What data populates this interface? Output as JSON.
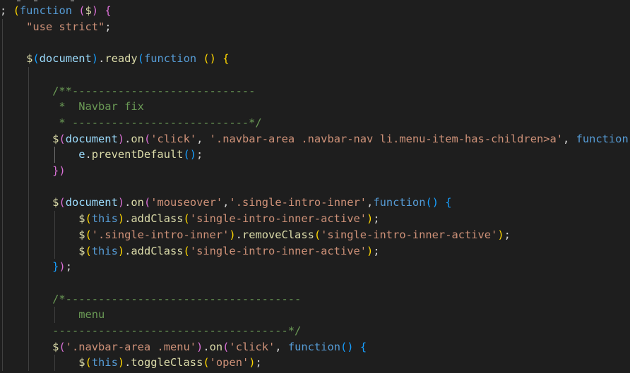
{
  "editor": {
    "lines": [
      [
        {
          "t": ";",
          "c": "punc"
        },
        {
          "t": " ",
          "c": "punc"
        },
        {
          "t": "(",
          "c": "b1"
        },
        {
          "t": "function",
          "c": "kw"
        },
        {
          "t": " ",
          "c": "punc"
        },
        {
          "t": "(",
          "c": "b2"
        },
        {
          "t": "$",
          "c": "fn"
        },
        {
          "t": ")",
          "c": "b2"
        },
        {
          "t": " ",
          "c": "punc"
        },
        {
          "t": "{",
          "c": "b2"
        }
      ],
      [
        {
          "t": "    ",
          "c": "punc"
        },
        {
          "t": "\"use strict\"",
          "c": "str"
        },
        {
          "t": ";",
          "c": "punc"
        }
      ],
      [],
      [
        {
          "t": "    ",
          "c": "punc"
        },
        {
          "t": "$",
          "c": "fn"
        },
        {
          "t": "(",
          "c": "b3"
        },
        {
          "t": "document",
          "c": "var"
        },
        {
          "t": ")",
          "c": "b3"
        },
        {
          "t": ".",
          "c": "punc"
        },
        {
          "t": "ready",
          "c": "fn"
        },
        {
          "t": "(",
          "c": "b3"
        },
        {
          "t": "function",
          "c": "kw"
        },
        {
          "t": " ",
          "c": "punc"
        },
        {
          "t": "()",
          "c": "b1"
        },
        {
          "t": " ",
          "c": "punc"
        },
        {
          "t": "{",
          "c": "b1"
        }
      ],
      [],
      [
        {
          "t": "        ",
          "c": "punc"
        },
        {
          "t": "/**----------------------------",
          "c": "cmt"
        }
      ],
      [
        {
          "t": "         ",
          "c": "punc"
        },
        {
          "t": "*  Navbar fix",
          "c": "cmt"
        }
      ],
      [
        {
          "t": "         ",
          "c": "punc"
        },
        {
          "t": "* ---------------------------*/",
          "c": "cmt"
        }
      ],
      [
        {
          "t": "        ",
          "c": "punc"
        },
        {
          "t": "$",
          "c": "fn"
        },
        {
          "t": "(",
          "c": "b2"
        },
        {
          "t": "document",
          "c": "var"
        },
        {
          "t": ")",
          "c": "b2"
        },
        {
          "t": ".",
          "c": "punc"
        },
        {
          "t": "on",
          "c": "fn"
        },
        {
          "t": "(",
          "c": "b2"
        },
        {
          "t": "'click'",
          "c": "str"
        },
        {
          "t": ", ",
          "c": "punc"
        },
        {
          "t": "'.navbar-area .navbar-nav li.menu-item-has-children>a'",
          "c": "str"
        },
        {
          "t": ", ",
          "c": "punc"
        },
        {
          "t": "function",
          "c": "kw"
        }
      ],
      [
        {
          "t": "            ",
          "c": "punc"
        },
        {
          "t": "e",
          "c": "var"
        },
        {
          "t": ".",
          "c": "punc"
        },
        {
          "t": "preventDefault",
          "c": "fn"
        },
        {
          "t": "()",
          "c": "b3"
        },
        {
          "t": ";",
          "c": "punc"
        }
      ],
      [
        {
          "t": "        ",
          "c": "punc"
        },
        {
          "t": "})",
          "c": "b2"
        }
      ],
      [],
      [
        {
          "t": "        ",
          "c": "punc"
        },
        {
          "t": "$",
          "c": "fn"
        },
        {
          "t": "(",
          "c": "b2"
        },
        {
          "t": "document",
          "c": "var"
        },
        {
          "t": ")",
          "c": "b2"
        },
        {
          "t": ".",
          "c": "punc"
        },
        {
          "t": "on",
          "c": "fn"
        },
        {
          "t": "(",
          "c": "b2"
        },
        {
          "t": "'mouseover'",
          "c": "str"
        },
        {
          "t": ",",
          "c": "punc"
        },
        {
          "t": "'.single-intro-inner'",
          "c": "str"
        },
        {
          "t": ",",
          "c": "punc"
        },
        {
          "t": "function",
          "c": "kw"
        },
        {
          "t": "()",
          "c": "b3"
        },
        {
          "t": " ",
          "c": "punc"
        },
        {
          "t": "{",
          "c": "b3"
        }
      ],
      [
        {
          "t": "            ",
          "c": "punc"
        },
        {
          "t": "$",
          "c": "fn"
        },
        {
          "t": "(",
          "c": "b1"
        },
        {
          "t": "this",
          "c": "kw"
        },
        {
          "t": ")",
          "c": "b1"
        },
        {
          "t": ".",
          "c": "punc"
        },
        {
          "t": "addClass",
          "c": "fn"
        },
        {
          "t": "(",
          "c": "b1"
        },
        {
          "t": "'single-intro-inner-active'",
          "c": "str"
        },
        {
          "t": ")",
          "c": "b1"
        },
        {
          "t": ";",
          "c": "punc"
        }
      ],
      [
        {
          "t": "            ",
          "c": "punc"
        },
        {
          "t": "$",
          "c": "fn"
        },
        {
          "t": "(",
          "c": "b1"
        },
        {
          "t": "'.single-intro-inner'",
          "c": "str"
        },
        {
          "t": ")",
          "c": "b1"
        },
        {
          "t": ".",
          "c": "punc"
        },
        {
          "t": "removeClass",
          "c": "fn"
        },
        {
          "t": "(",
          "c": "b1"
        },
        {
          "t": "'single-intro-inner-active'",
          "c": "str"
        },
        {
          "t": ")",
          "c": "b1"
        },
        {
          "t": ";",
          "c": "punc"
        }
      ],
      [
        {
          "t": "            ",
          "c": "punc"
        },
        {
          "t": "$",
          "c": "fn"
        },
        {
          "t": "(",
          "c": "b1"
        },
        {
          "t": "this",
          "c": "kw"
        },
        {
          "t": ")",
          "c": "b1"
        },
        {
          "t": ".",
          "c": "punc"
        },
        {
          "t": "addClass",
          "c": "fn"
        },
        {
          "t": "(",
          "c": "b1"
        },
        {
          "t": "'single-intro-inner-active'",
          "c": "str"
        },
        {
          "t": ")",
          "c": "b1"
        },
        {
          "t": ";",
          "c": "punc"
        }
      ],
      [
        {
          "t": "        ",
          "c": "punc"
        },
        {
          "t": "}",
          "c": "b3"
        },
        {
          "t": ")",
          "c": "b2"
        },
        {
          "t": ";",
          "c": "punc"
        }
      ],
      [],
      [
        {
          "t": "        ",
          "c": "punc"
        },
        {
          "t": "/*------------------------------------",
          "c": "cmt"
        }
      ],
      [
        {
          "t": "            ",
          "c": "punc"
        },
        {
          "t": "menu",
          "c": "cmt"
        }
      ],
      [
        {
          "t": "        ",
          "c": "punc"
        },
        {
          "t": "------------------------------------*/",
          "c": "cmt"
        }
      ],
      [
        {
          "t": "        ",
          "c": "punc"
        },
        {
          "t": "$",
          "c": "fn"
        },
        {
          "t": "(",
          "c": "b2"
        },
        {
          "t": "'.navbar-area .menu'",
          "c": "str"
        },
        {
          "t": ")",
          "c": "b2"
        },
        {
          "t": ".",
          "c": "punc"
        },
        {
          "t": "on",
          "c": "fn"
        },
        {
          "t": "(",
          "c": "b2"
        },
        {
          "t": "'click'",
          "c": "str"
        },
        {
          "t": ", ",
          "c": "punc"
        },
        {
          "t": "function",
          "c": "kw"
        },
        {
          "t": "()",
          "c": "b3"
        },
        {
          "t": " ",
          "c": "punc"
        },
        {
          "t": "{",
          "c": "b3"
        }
      ],
      [
        {
          "t": "            ",
          "c": "punc"
        },
        {
          "t": "$",
          "c": "fn"
        },
        {
          "t": "(",
          "c": "b1"
        },
        {
          "t": "this",
          "c": "kw"
        },
        {
          "t": ")",
          "c": "b1"
        },
        {
          "t": ".",
          "c": "punc"
        },
        {
          "t": "toggleClass",
          "c": "fn"
        },
        {
          "t": "(",
          "c": "b1"
        },
        {
          "t": "'open'",
          "c": "str"
        },
        {
          "t": ")",
          "c": "b1"
        },
        {
          "t": ";",
          "c": "punc"
        }
      ]
    ]
  },
  "theme": {
    "background": "#1e1e1e",
    "text": "#d4d4d4",
    "keyword": "#569cd6",
    "function": "#dcdcaa",
    "variable": "#9cdcfe",
    "string": "#ce9178",
    "comment": "#6a9955",
    "bracket_gold": "#ffd700",
    "bracket_orchid": "#da70d6",
    "bracket_blue": "#179fff",
    "indent_guide": "#404040"
  }
}
